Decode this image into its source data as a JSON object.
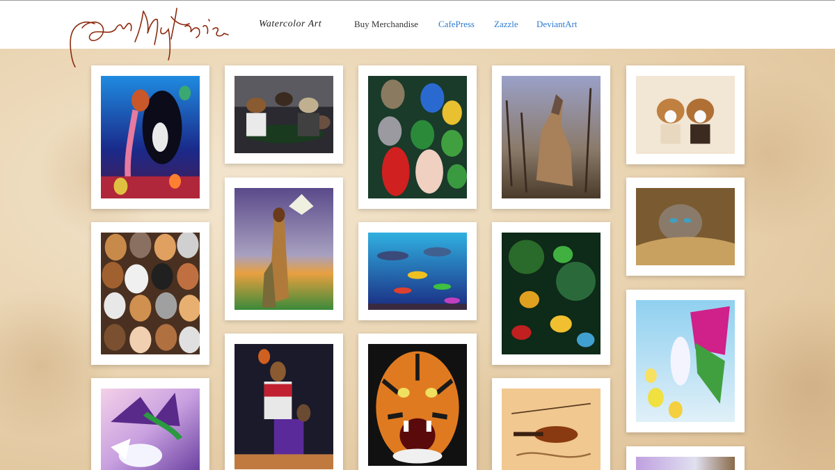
{
  "header": {
    "signature_alt": "Dan McManis",
    "nav": [
      {
        "label": "Watercolor Art",
        "style": "script"
      },
      {
        "label": "Buy Merchandise",
        "style": "plain"
      },
      {
        "label": "CafePress",
        "style": "link"
      },
      {
        "label": "Zazzle",
        "style": "link"
      },
      {
        "label": "DeviantArt",
        "style": "link"
      }
    ],
    "colors": {
      "link": "#2a7ad0",
      "signature": "#8b2a0e",
      "text": "#333333"
    }
  },
  "gallery": {
    "items": [
      {
        "subject": "mermaid and orca"
      },
      {
        "subject": "dogs playing poker"
      },
      {
        "subject": "parrots"
      },
      {
        "subject": "howling wolf"
      },
      {
        "subject": "beagle puppies"
      },
      {
        "subject": "kittens collage"
      },
      {
        "subject": "native american warrior"
      },
      {
        "subject": "underwater fish and dolphins"
      },
      {
        "subject": "tree frogs"
      },
      {
        "subject": "kitten in basket"
      },
      {
        "subject": "dragon and pegasus"
      },
      {
        "subject": "basketball dogs"
      },
      {
        "subject": "roaring tiger"
      },
      {
        "subject": "violins"
      },
      {
        "subject": "fairy with flowers"
      },
      {
        "subject": "partial painting"
      }
    ]
  }
}
